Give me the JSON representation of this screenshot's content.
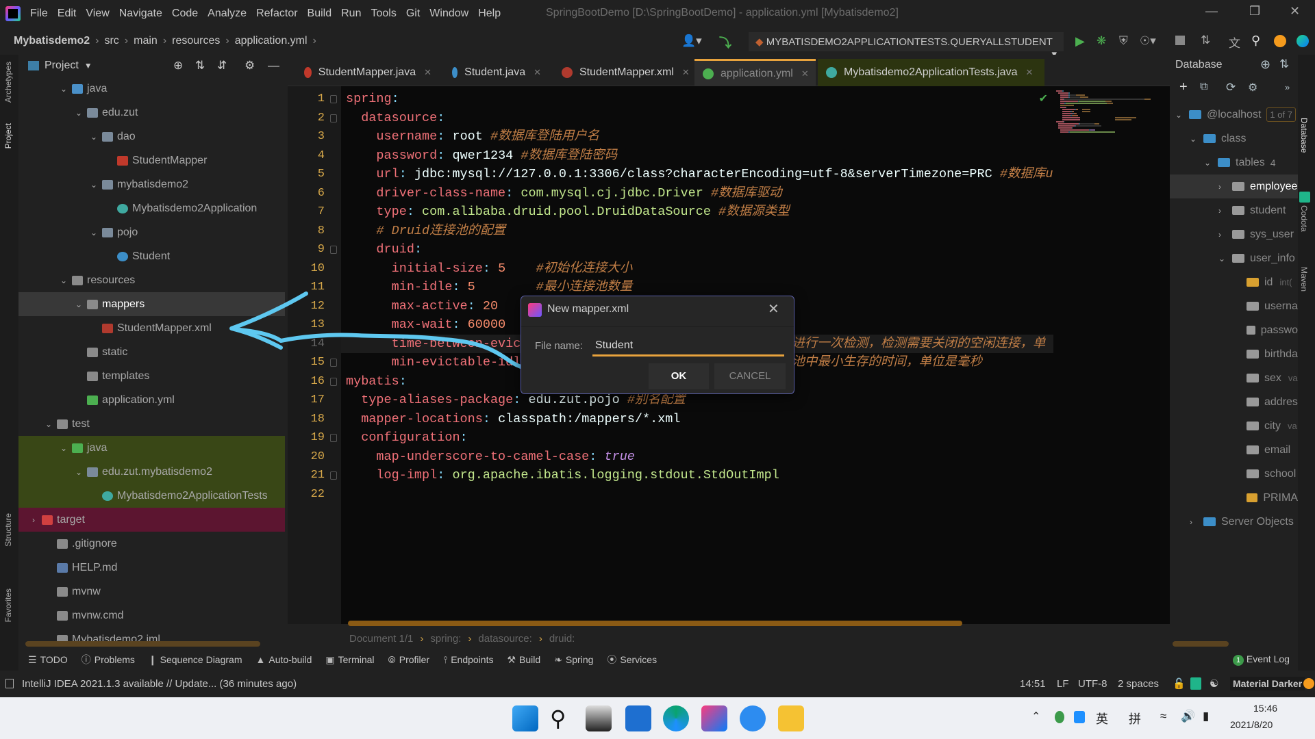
{
  "menubar": {
    "items": [
      "File",
      "Edit",
      "View",
      "Navigate",
      "Code",
      "Analyze",
      "Refactor",
      "Build",
      "Run",
      "Tools",
      "Git",
      "Window",
      "Help"
    ],
    "window_title": "SpringBootDemo [D:\\SpringBootDemo] - application.yml [Mybatisdemo2]"
  },
  "navbar": {
    "crumbs": [
      "Mybatisdemo2",
      "src",
      "main",
      "resources",
      "application.yml"
    ],
    "run_config": "MYBATISDEMO2APPLICATIONTESTS.QUERYALLSTUDENT"
  },
  "left_strip": [
    "Archetypes",
    "Project",
    "Structure",
    "Favorites"
  ],
  "right_strip": [
    "Database",
    "Codota",
    "Maven"
  ],
  "project": {
    "title": "Project",
    "tree": [
      {
        "label": "java",
        "level": 2,
        "arrow": "open",
        "icon": "folder-src"
      },
      {
        "label": "edu.zut",
        "level": 3,
        "arrow": "open",
        "icon": "package"
      },
      {
        "label": "dao",
        "level": 4,
        "arrow": "open",
        "icon": "package"
      },
      {
        "label": "StudentMapper",
        "level": 5,
        "icon": "mapper"
      },
      {
        "label": "mybatisdemo2",
        "level": 4,
        "arrow": "open",
        "icon": "package"
      },
      {
        "label": "Mybatisdemo2Application",
        "level": 5,
        "icon": "spring-class"
      },
      {
        "label": "pojo",
        "level": 4,
        "arrow": "open",
        "icon": "package"
      },
      {
        "label": "Student",
        "level": 5,
        "icon": "class"
      },
      {
        "label": "resources",
        "level": 2,
        "arrow": "open",
        "icon": "folder-res"
      },
      {
        "label": "mappers",
        "level": 3,
        "arrow": "open",
        "icon": "folder",
        "state": "selected"
      },
      {
        "label": "StudentMapper.xml",
        "level": 4,
        "icon": "xml"
      },
      {
        "label": "static",
        "level": 3,
        "icon": "folder"
      },
      {
        "label": "templates",
        "level": 3,
        "icon": "folder"
      },
      {
        "label": "application.yml",
        "level": 3,
        "icon": "yml"
      },
      {
        "label": "test",
        "level": 1,
        "arrow": "open",
        "icon": "folder"
      },
      {
        "label": "java",
        "level": 2,
        "arrow": "open",
        "icon": "folder-test",
        "state": "test"
      },
      {
        "label": "edu.zut.mybatisdemo2",
        "level": 3,
        "arrow": "open",
        "icon": "package",
        "state": "test"
      },
      {
        "label": "Mybatisdemo2ApplicationTests",
        "level": 4,
        "icon": "spring-class",
        "state": "test"
      },
      {
        "label": "target",
        "level": 0,
        "arrow": "closed",
        "icon": "folder-excluded",
        "state": "excluded"
      },
      {
        "label": ".gitignore",
        "level": 1,
        "icon": "file"
      },
      {
        "label": "HELP.md",
        "level": 1,
        "icon": "md"
      },
      {
        "label": "mvnw",
        "level": 1,
        "icon": "file"
      },
      {
        "label": "mvnw.cmd",
        "level": 1,
        "icon": "file"
      },
      {
        "label": "Mybatisdemo2.iml",
        "level": 1,
        "icon": "file"
      }
    ]
  },
  "tabs": [
    {
      "label": "StudentMapper.java",
      "icon": "mapper"
    },
    {
      "label": "Student.java",
      "icon": "class"
    },
    {
      "label": "StudentMapper.xml",
      "icon": "xml"
    },
    {
      "label": "application.yml",
      "icon": "yml",
      "active": true
    },
    {
      "label": "Mybatisdemo2ApplicationTests.java",
      "icon": "spring-class",
      "test": true
    }
  ],
  "code": [
    [
      [
        "k",
        "spring"
      ],
      [
        "p",
        ":"
      ]
    ],
    [
      [
        "v",
        "  "
      ],
      [
        "k",
        "datasource"
      ],
      [
        "p",
        ":"
      ]
    ],
    [
      [
        "v",
        "    "
      ],
      [
        "k",
        "username"
      ],
      [
        "p",
        ":"
      ],
      [
        "v",
        " root "
      ],
      [
        "c",
        "#数据库登陆用户名"
      ]
    ],
    [
      [
        "v",
        "    "
      ],
      [
        "k",
        "password"
      ],
      [
        "p",
        ":"
      ],
      [
        "v",
        " qwer1234 "
      ],
      [
        "c",
        "#数据库登陆密码"
      ]
    ],
    [
      [
        "v",
        "    "
      ],
      [
        "k",
        "url"
      ],
      [
        "p",
        ":"
      ],
      [
        "v",
        " jdbc:mysql://127.0.0.1:3306/class?characterEncoding=utf-8&serverTimezone=PRC "
      ],
      [
        "c",
        "#数据库ur"
      ]
    ],
    [
      [
        "v",
        "    "
      ],
      [
        "k",
        "driver-class-name"
      ],
      [
        "p",
        ":"
      ],
      [
        "s",
        " com.mysql.cj.jdbc.Driver "
      ],
      [
        "c",
        "#数据库驱动"
      ]
    ],
    [
      [
        "v",
        "    "
      ],
      [
        "k",
        "type"
      ],
      [
        "p",
        ":"
      ],
      [
        "s",
        " com.alibaba.druid.pool.DruidDataSource "
      ],
      [
        "c",
        "#数据源类型"
      ]
    ],
    [
      [
        "v",
        "    "
      ],
      [
        "c",
        "# Druid连接池的配置"
      ]
    ],
    [
      [
        "v",
        "    "
      ],
      [
        "k",
        "druid"
      ],
      [
        "p",
        ":"
      ]
    ],
    [
      [
        "v",
        "      "
      ],
      [
        "k",
        "initial-size"
      ],
      [
        "p",
        ":"
      ],
      [
        "n",
        " 5"
      ],
      [
        "v",
        "    "
      ],
      [
        "c",
        "#初始化连接大小"
      ]
    ],
    [
      [
        "v",
        "      "
      ],
      [
        "k",
        "min-idle"
      ],
      [
        "p",
        ":"
      ],
      [
        "n",
        " 5"
      ],
      [
        "v",
        "        "
      ],
      [
        "c",
        "#最小连接池数量"
      ]
    ],
    [
      [
        "v",
        "      "
      ],
      [
        "k",
        "max-active"
      ],
      [
        "p",
        ":"
      ],
      [
        "n",
        " 20"
      ]
    ],
    [
      [
        "v",
        "      "
      ],
      [
        "k",
        "max-wait"
      ],
      [
        "p",
        ":"
      ],
      [
        "n",
        " 60000"
      ]
    ],
    [
      [
        "v",
        "      "
      ],
      [
        "k",
        "time-between-evic"
      ],
      [
        "v",
        "                                  "
      ],
      [
        "c",
        "对进行一次检测，检测需要关闭的空闲连接，单"
      ]
    ],
    [
      [
        "v",
        "      "
      ],
      [
        "k",
        "min-evictable-idl"
      ],
      [
        "v",
        "                                  "
      ],
      [
        "c",
        "连池中最小生存的时间，单位是毫秒"
      ]
    ],
    [
      [
        "k",
        "mybatis"
      ],
      [
        "p",
        ":"
      ]
    ],
    [
      [
        "v",
        "  "
      ],
      [
        "k",
        "type-aliases-package"
      ],
      [
        "p",
        ":"
      ],
      [
        "v",
        " edu.zut.pojo "
      ],
      [
        "c",
        "#别名配置"
      ]
    ],
    [
      [
        "v",
        "  "
      ],
      [
        "k",
        "mapper-locations"
      ],
      [
        "p",
        ":"
      ],
      [
        "v",
        " classpath:/mappers/*.xml"
      ]
    ],
    [
      [
        "v",
        "  "
      ],
      [
        "k",
        "configuration"
      ],
      [
        "p",
        ":"
      ]
    ],
    [
      [
        "v",
        "    "
      ],
      [
        "k",
        "map-underscore-to-camel-case"
      ],
      [
        "p",
        ":"
      ],
      [
        "b",
        " true"
      ]
    ],
    [
      [
        "v",
        "    "
      ],
      [
        "k",
        "log-impl"
      ],
      [
        "p",
        ":"
      ],
      [
        "s",
        " org.apache.ibatis.logging.stdout.StdOutImpl"
      ]
    ],
    []
  ],
  "current_line": 14,
  "editor_breadcrumb": [
    "Document 1/1",
    "spring:",
    "datasource:",
    "druid:"
  ],
  "database": {
    "title": "Database",
    "tree": [
      {
        "label": "@localhost",
        "level": 0,
        "arrow": "open",
        "icon": "mysql",
        "badge": "1 of 7"
      },
      {
        "label": "class",
        "level": 1,
        "arrow": "open",
        "icon": "schema"
      },
      {
        "label": "tables",
        "level": 2,
        "arrow": "open",
        "icon": "folder",
        "count": "4"
      },
      {
        "label": "employee",
        "level": 3,
        "arrow": "closed",
        "icon": "table",
        "state": "selected"
      },
      {
        "label": "student",
        "level": 3,
        "arrow": "closed",
        "icon": "table"
      },
      {
        "label": "sys_user",
        "level": 3,
        "arrow": "closed",
        "icon": "table"
      },
      {
        "label": "user_info",
        "level": 3,
        "arrow": "open",
        "icon": "table"
      },
      {
        "label": "id",
        "type": "int(",
        "level": 4,
        "icon": "column-key"
      },
      {
        "label": "userna",
        "level": 4,
        "icon": "column"
      },
      {
        "label": "passwo",
        "level": 4,
        "icon": "column"
      },
      {
        "label": "birthda",
        "level": 4,
        "icon": "column"
      },
      {
        "label": "sex",
        "type": "va",
        "level": 4,
        "icon": "column"
      },
      {
        "label": "addres",
        "level": 4,
        "icon": "column"
      },
      {
        "label": "city",
        "type": "va",
        "level": 4,
        "icon": "column"
      },
      {
        "label": "email",
        "level": 4,
        "icon": "column"
      },
      {
        "label": "school",
        "level": 4,
        "icon": "column"
      },
      {
        "label": "PRIMA",
        "level": 4,
        "icon": "key"
      },
      {
        "label": "Server Objects",
        "level": 1,
        "arrow": "closed",
        "icon": "folder"
      }
    ]
  },
  "dialog": {
    "title": "New mapper.xml",
    "file_name_label": "File name:",
    "file_name_value": "Student",
    "ok": "OK",
    "cancel": "CANCEL"
  },
  "tool_windows": [
    "TODO",
    "Problems",
    "Sequence Diagram",
    "Auto-build",
    "Terminal",
    "Profiler",
    "Endpoints",
    "Build",
    "Spring",
    "Services"
  ],
  "event_log": {
    "label": "Event Log",
    "badge": "1"
  },
  "status": {
    "message": "IntelliJ IDEA 2021.1.3 available // Update... (36 minutes ago)",
    "position": "14:51",
    "line_sep": "LF",
    "encoding": "UTF-8",
    "indent": "2 spaces",
    "theme": "Material Darker"
  },
  "taskbar": {
    "ime1": "英",
    "ime2": "拼",
    "time": "15:46",
    "date": "2021/8/20"
  },
  "colors": {
    "accent": "#e8a33d",
    "annotation": "#5ec8f0",
    "key": "#f07178",
    "comment": "#c17e46"
  }
}
